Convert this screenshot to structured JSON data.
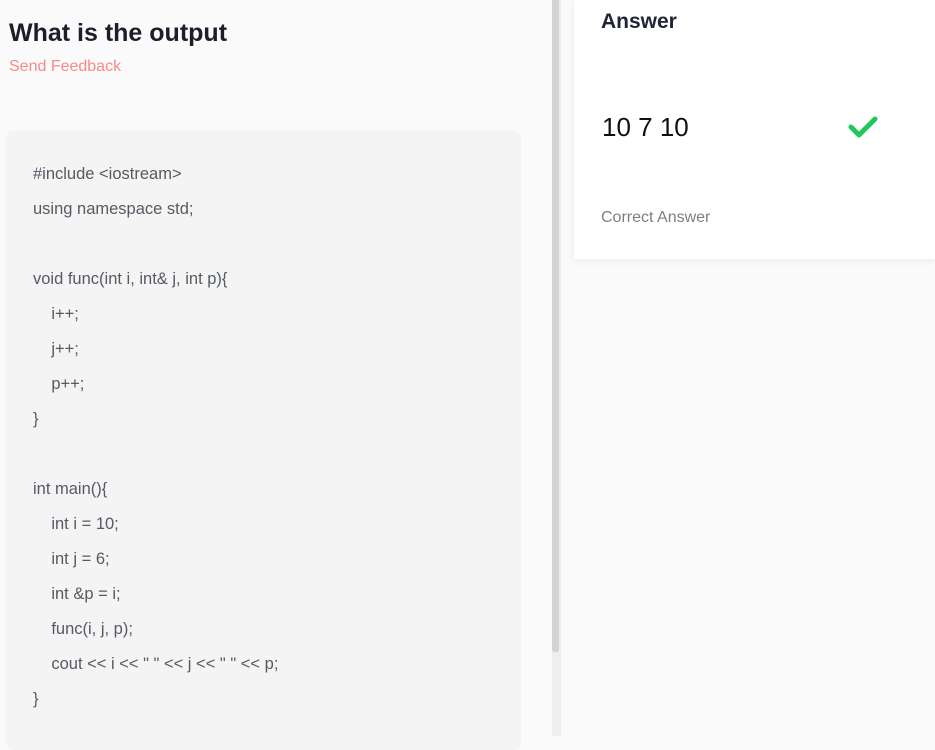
{
  "question": {
    "title": "What is the output",
    "feedback_link": "Send Feedback"
  },
  "code_lines": [
    "#include <iostream>",
    "using namespace std;",
    "",
    "void func(int i, int& j, int p){",
    "    i++;",
    "    j++;",
    "    p++;",
    "}",
    "",
    "int main(){",
    "    int i = 10;",
    "    int j = 6;",
    "    int &p = i;",
    "    func(i, j, p);",
    "    cout << i << \" \" << j << \" \" << p;",
    "}"
  ],
  "answer": {
    "heading": "Answer",
    "value": "10 7 10",
    "status": "Correct Answer",
    "status_icon": "check-icon",
    "status_color": "#1ec85a"
  }
}
